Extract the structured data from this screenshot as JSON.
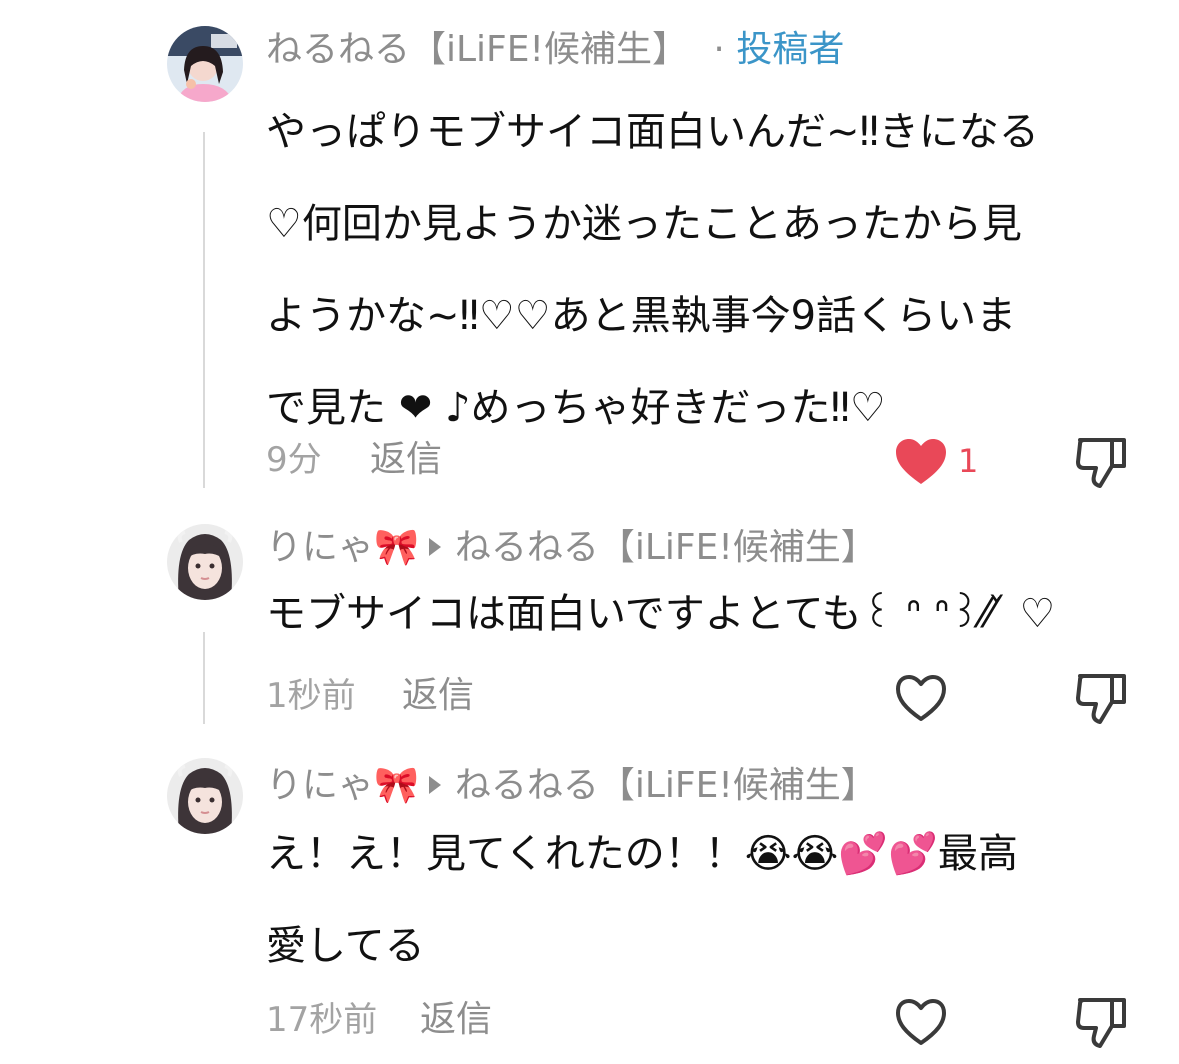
{
  "comments": [
    {
      "author": "ねるねる【iLiFE!候補生】",
      "separator": "·",
      "role": "投稿者",
      "lines": [
        "やっぱりモブサイコ面白いんだ~‼きになる",
        "♡何回か見ようか迷ったことあったから見",
        "ようかな~‼♡♡あと黒執事今9話くらいま",
        "で見た ❤︎ ♪めっちゃ好きだった‼♡"
      ],
      "time": "9分",
      "reply_label": "返信",
      "liked": true,
      "like_count": "1"
    },
    {
      "author": "りにゃ🎀",
      "reply_to": "ねるねる【iLiFE!候補生】",
      "lines": [
        "モブサイコは面白いですよとても꒰ ᐢ ᐢ꒱⁄⁄ ̌ ♡"
      ],
      "time": "1秒前",
      "reply_label": "返信",
      "liked": false
    },
    {
      "author": "りにゃ🎀",
      "reply_to": "ねるねる【iLiFE!候補生】",
      "lines": [
        "え！え！見てくれたの！！😭😭💕💕最高",
        "愛してる"
      ],
      "time": "17秒前",
      "reply_label": "返信",
      "liked": false
    }
  ],
  "icons": {
    "like_filled": "heart-filled-icon",
    "like_outline": "heart-outline-icon",
    "dislike": "thumbs-down-icon",
    "reply_arrow": "reply-arrow-icon"
  },
  "colors": {
    "like_red": "#e94858",
    "creator_blue": "#3b95c8",
    "meta_gray": "#8d8d8d"
  }
}
